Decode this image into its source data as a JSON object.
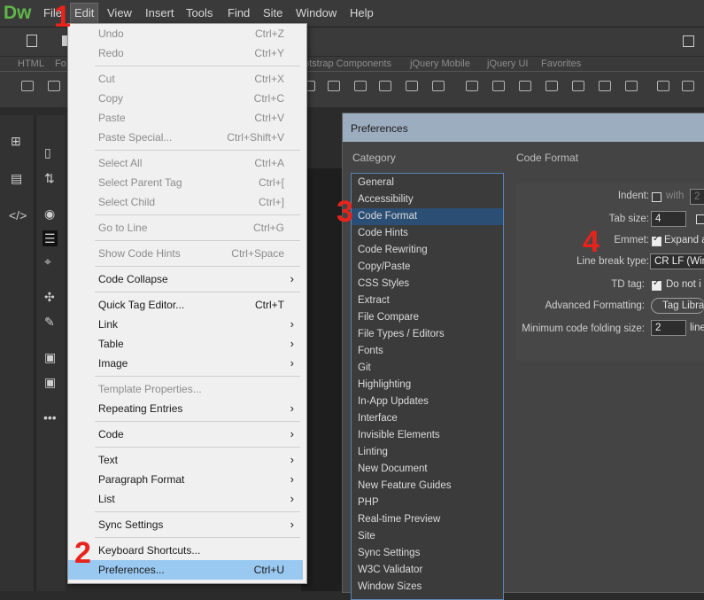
{
  "app": {
    "logo": "Dw"
  },
  "menubar": [
    {
      "label": "File",
      "name": "menu-file"
    },
    {
      "label": "Edit",
      "name": "menu-edit"
    },
    {
      "label": "View",
      "name": "menu-view"
    },
    {
      "label": "Insert",
      "name": "menu-insert"
    },
    {
      "label": "Tools",
      "name": "menu-tools"
    },
    {
      "label": "Find",
      "name": "menu-find"
    },
    {
      "label": "Site",
      "name": "menu-site"
    },
    {
      "label": "Window",
      "name": "menu-window"
    },
    {
      "label": "Help",
      "name": "menu-help"
    }
  ],
  "insertbar": {
    "tabs": [
      "HTML",
      "Fo",
      "otstrap Components",
      "jQuery Mobile",
      "jQuery UI",
      "Favorites"
    ]
  },
  "edit_menu": {
    "items": [
      {
        "label": "Undo",
        "shortcut": "Ctrl+Z",
        "disabled": true
      },
      {
        "label": "Redo",
        "shortcut": "Ctrl+Y",
        "disabled": true
      },
      {
        "label": "Cut",
        "shortcut": "Ctrl+X",
        "disabled": true
      },
      {
        "label": "Copy",
        "shortcut": "Ctrl+C",
        "disabled": true
      },
      {
        "label": "Paste",
        "shortcut": "Ctrl+V",
        "disabled": true
      },
      {
        "label": "Paste Special...",
        "shortcut": "Ctrl+Shift+V",
        "disabled": true
      },
      {
        "label": "Select All",
        "shortcut": "Ctrl+A",
        "disabled": true
      },
      {
        "label": "Select Parent Tag",
        "shortcut": "Ctrl+[",
        "disabled": true
      },
      {
        "label": "Select Child",
        "shortcut": "Ctrl+]",
        "disabled": true
      },
      {
        "label": "Go to Line",
        "shortcut": "Ctrl+G",
        "disabled": true
      },
      {
        "label": "Show Code Hints",
        "shortcut": "Ctrl+Space",
        "disabled": true
      },
      {
        "label": "Code Collapse",
        "submenu": true
      },
      {
        "label": "Quick Tag Editor...",
        "shortcut": "Ctrl+T"
      },
      {
        "label": "Link",
        "submenu": true
      },
      {
        "label": "Table",
        "submenu": true
      },
      {
        "label": "Image",
        "submenu": true
      },
      {
        "label": "Template Properties...",
        "disabled": true
      },
      {
        "label": "Repeating Entries",
        "submenu": true
      },
      {
        "label": "Code",
        "submenu": true
      },
      {
        "label": "Text",
        "submenu": true
      },
      {
        "label": "Paragraph Format",
        "submenu": true
      },
      {
        "label": "List",
        "submenu": true
      },
      {
        "label": "Sync Settings",
        "submenu": true
      },
      {
        "label": "Keyboard Shortcuts..."
      },
      {
        "label": "Preferences...",
        "shortcut": "Ctrl+U",
        "selected": true
      }
    ]
  },
  "preferences": {
    "title": "Preferences",
    "category_header": "Category",
    "section_header": "Code Format",
    "selected_category": "Code Format",
    "categories": [
      "General",
      "Accessibility",
      "Code Format",
      "Code Hints",
      "Code Rewriting",
      "Copy/Paste",
      "CSS Styles",
      "Extract",
      "File Compare",
      "File Types / Editors",
      "Fonts",
      "Git",
      "Highlighting",
      "In-App Updates",
      "Interface",
      "Invisible Elements",
      "Linting",
      "New Document",
      "New Feature Guides",
      "PHP",
      "Real-time Preview",
      "Site",
      "Sync Settings",
      "W3C Validator",
      "Window Sizes"
    ],
    "options": {
      "indent_label": "Indent:",
      "indent_checked": false,
      "indent_with": "with",
      "indent_value": "2",
      "tab_size_label": "Tab size:",
      "tab_size_value": "4",
      "emmet_label": "Emmet:",
      "emmet_checked": true,
      "emmet_text": "Expand a",
      "line_break_label": "Line break type:",
      "line_break_value": "CR LF (Win",
      "td_tag_label": "TD tag:",
      "td_tag_checked": true,
      "td_tag_text": "Do not i",
      "advanced_label": "Advanced Formatting:",
      "advanced_button": "Tag Libra",
      "min_fold_label": "Minimum code folding size:",
      "min_fold_value": "2",
      "min_fold_unit": "line"
    }
  },
  "annotations": [
    "1",
    "2",
    "3",
    "4"
  ],
  "colors": {
    "accent": "#5fb649",
    "menu_selected": "#99c8f0",
    "category_selected": "#2b4e75",
    "dialog_title": "#9dadc0",
    "annotation": "#e8231c"
  }
}
